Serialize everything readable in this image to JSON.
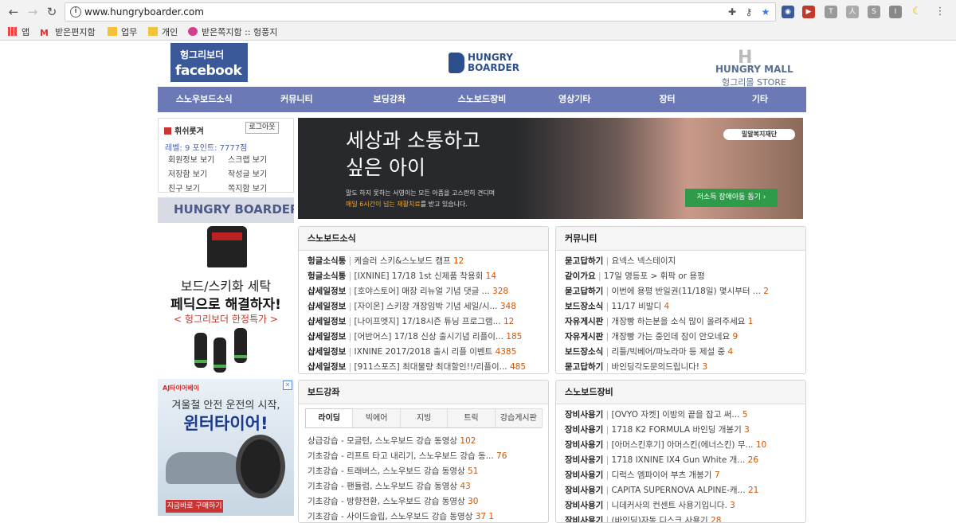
{
  "browser": {
    "url": "www.hungryboarder.com",
    "bookmarks": [
      {
        "label": "앱",
        "icon": "apps-grid-icon"
      },
      {
        "label": "받은편지함",
        "icon": "gmail-icon"
      },
      {
        "label": "업무",
        "icon": "folder-icon"
      },
      {
        "label": "개인",
        "icon": "folder-icon"
      },
      {
        "label": "받은쪽지함 :: 헝풍지",
        "icon": "site-favicon-icon"
      }
    ]
  },
  "header": {
    "fb_line1": "헝그리보더",
    "fb_line2": "facebook",
    "logo_line1": "HUNGRY",
    "logo_line2": "BOARDER",
    "mall_h": "H",
    "mall_line1": "HUNGRY MALL",
    "mall_line2": "헝그리몰 STORE"
  },
  "nav": [
    "스노우보드소식",
    "커뮤니티",
    "보딩강좌",
    "스노보드장비",
    "영상기타",
    "장터",
    "기타"
  ],
  "login": {
    "username": "휘쉬롯겨",
    "logout": "로그아웃",
    "level_text": "레벨:  9   포인트:  7777점",
    "links": [
      "회원정보 보기",
      "스크랩 보기",
      "저장함 보기",
      "작성글 보기",
      "친구 보기",
      "쪽지함 보기"
    ]
  },
  "sidebar": {
    "hb_banner": "HUNGRY BOARDER 생활백서",
    "ad1_line1": "보드/스키화 세탁",
    "ad1_line2": "페딕으로 해결하자!",
    "ad1_line3": "< 헝그리보더 한정특가 >",
    "ad2_brand": "AJ타이어베이",
    "ad2_line1": "겨울철 안전 운전의 시작,",
    "ad2_line2": "윈터타이어!",
    "ad2_cta": "지금바로 구매하기"
  },
  "banner": {
    "headline1": "세상과 소통하고",
    "headline2": "싶은 아이",
    "sub1": "말도 하지 못하는 서영이는 모든 아픔을 고스란히 견디며",
    "sub2_prefix": "매일 6시간이 넘는 재활치료",
    "sub2_suffix": "를 받고 있습니다.",
    "org": "밀알복지재단",
    "button": "저소득 장애아동 돕기 ›"
  },
  "news": {
    "title": "스노보드소식",
    "items": [
      {
        "cat": "헝글소식통",
        "text": "케슬러 스키&스노보드 캠프",
        "count": "12"
      },
      {
        "cat": "헝글소식통",
        "text": "[IXNINE] 17/18 1st 신제품 착용회",
        "count": "14"
      },
      {
        "cat": "샵세일정보",
        "text": "[호야스토어] 매장 리뉴얼 기념 댓글 ...",
        "count": "328"
      },
      {
        "cat": "샵세일정보",
        "text": "[자이온] 스키장 개장임박 기념 세일/시...",
        "count": "348"
      },
      {
        "cat": "샵세일정보",
        "text": "[나이프엣지] 17/18시즌 튜닝 프로그램...",
        "count": "12"
      },
      {
        "cat": "샵세일정보",
        "text": "[어반어스] 17/18 신상 출시기념 리플이...",
        "count": "185"
      },
      {
        "cat": "샵세일정보",
        "text": "IXNINE 2017/2018 출시 리플 이벤트",
        "count": "4385"
      },
      {
        "cat": "샵세일정보",
        "text": "[911스포즈] 최대물량 최대할인!!/리플이...",
        "count": "485"
      }
    ]
  },
  "community": {
    "title": "커뮤니티",
    "items": [
      {
        "cat": "묻고답하기",
        "text": "요넥스 넥스테이지",
        "count": ""
      },
      {
        "cat": "같이가요",
        "text": "17일 영등포 > 휘팍 or 용평",
        "count": ""
      },
      {
        "cat": "묻고답하기",
        "text": "이번에 용평 반일권(11/18일) 몇시부터 ...",
        "count": "2"
      },
      {
        "cat": "보드장소식",
        "text": "11/17 비발디",
        "count": "4"
      },
      {
        "cat": "자유게시판",
        "text": "개장빵 하는분을 소식 많이 올려주세요",
        "count": "1"
      },
      {
        "cat": "자유게시판",
        "text": "개장빵 가는 중인데 잠이 안오네요",
        "count": "9"
      },
      {
        "cat": "보드장소식",
        "text": "리틀/빅베어/파노라마 등 제설 중",
        "count": "4"
      },
      {
        "cat": "묻고답하기",
        "text": "바인딩각도문의드립니다!",
        "count": "3"
      }
    ]
  },
  "lessons": {
    "title": "보드강좌",
    "tabs": [
      "라이딩",
      "빅에어",
      "지빙",
      "트릭",
      "강습게시판"
    ],
    "items": [
      {
        "text": "상급강습 - 모글턴, 스노우보드 강습 동영상",
        "count": "102"
      },
      {
        "text": "기초강습 - 리프트 타고 내리기, 스노우보드 강습 동...",
        "count": "76"
      },
      {
        "text": "기초강습 - 트래버스, 스노우보드 강습 동영상",
        "count": "51"
      },
      {
        "text": "기초강습 - 팬듈럼, 스노우보드 강습 동영상",
        "count": "43"
      },
      {
        "text": "기초강습 - 방향전환, 스노우보드 강습 동영상",
        "count": "30"
      },
      {
        "text": "기초강습 - 사이드슬립, 스노우보드 강습 동영상",
        "count": "37 1"
      }
    ]
  },
  "gear": {
    "title": "스노보드장비",
    "items": [
      {
        "cat": "장비사용기",
        "text": "[OVYO 자켓] 이방의 끝을 잡고 써...",
        "count": "5"
      },
      {
        "cat": "장비사용기",
        "text": "1718 K2 FORMULA 바인딩 개봉기",
        "count": "3"
      },
      {
        "cat": "장비사용기",
        "text": "[아머스킨후기] 아머스킨(에너스킨) 무...",
        "count": "10"
      },
      {
        "cat": "장비사용기",
        "text": "1718 IXNINE IX4 Gun White 개...",
        "count": "26"
      },
      {
        "cat": "장비사용기",
        "text": "디럭스 엠파이어 부츠 개봉기",
        "count": "7"
      },
      {
        "cat": "장비사용기",
        "text": "CAPITA SUPERNOVA ALPINE-캐...",
        "count": "21"
      },
      {
        "cat": "장비사용기",
        "text": "니데커사의 컨센트 사용기입니다.",
        "count": "3"
      },
      {
        "cat": "장비사용기",
        "text": "(바인딩)자동 디스크 사용기",
        "count": "28"
      }
    ]
  }
}
